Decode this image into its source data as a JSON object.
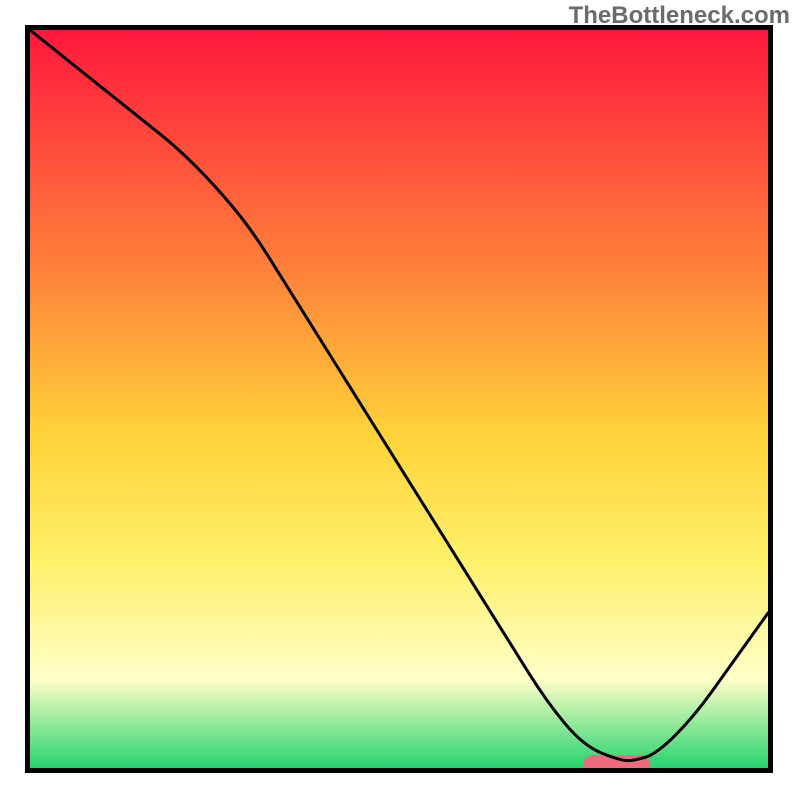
{
  "watermark": "TheBottleneck.com",
  "colors": {
    "border": "#000000",
    "watermark": "#6b6b6b",
    "blob_fill": "#f06a7e",
    "curve": "#000000",
    "grad_top": "#ff183d",
    "grad_upper_mid": "#ff8a3a",
    "grad_mid": "#ffd33a",
    "grad_lower_mid": "#fff06a",
    "grad_pale": "#ffffc8",
    "grad_bottom": "#25d36e"
  },
  "chart_data": {
    "type": "line",
    "title": "",
    "xlabel": "",
    "ylabel": "",
    "xlim": [
      0,
      100
    ],
    "ylim": [
      0,
      100
    ],
    "grid": false,
    "series": [
      {
        "name": "bottleneck_curve",
        "x": [
          0,
          5,
          10,
          15,
          20,
          25,
          30,
          35,
          40,
          45,
          50,
          55,
          60,
          65,
          70,
          75,
          80,
          82,
          85,
          90,
          95,
          100
        ],
        "y": [
          100,
          96,
          92,
          88,
          84,
          79,
          73,
          65,
          57,
          49,
          41,
          33,
          25,
          17,
          9,
          3,
          1,
          1,
          2,
          7,
          14,
          21
        ]
      }
    ],
    "marker": {
      "name": "optimal_zone",
      "x_range": [
        75,
        84
      ],
      "y": 0.5,
      "color": "#f06a7e"
    },
    "background_gradient": {
      "stops": [
        {
          "pos": 0.0,
          "color": "#ff183d"
        },
        {
          "pos": 0.35,
          "color": "#ff8a3a"
        },
        {
          "pos": 0.55,
          "color": "#ffd33a"
        },
        {
          "pos": 0.72,
          "color": "#fff06a"
        },
        {
          "pos": 0.88,
          "color": "#ffffc8"
        },
        {
          "pos": 1.0,
          "color": "#25d36e"
        }
      ]
    }
  }
}
